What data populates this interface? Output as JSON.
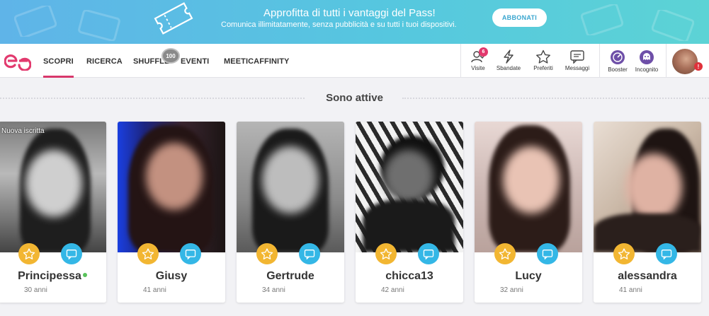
{
  "banner": {
    "title": "Approfitta di tutti i vantaggi del Pass!",
    "subtitle": "Comunica illimitatamente, senza pubblicità e su tutti i tuoi dispositivi.",
    "cta": "ABBONATI"
  },
  "nav": {
    "logo_icon": "meetic-logo",
    "items": [
      "SCOPRI",
      "RICERCA",
      "SHUFFLE",
      "EVENTI",
      "MEETICAFFINITY"
    ],
    "shuffle_count": "100",
    "active": "SCOPRI"
  },
  "actions": [
    {
      "label": "Visite",
      "icon": "visits-icon",
      "badge": "6"
    },
    {
      "label": "Sbandate",
      "icon": "flash-icon"
    },
    {
      "label": "Preferiti",
      "icon": "star-icon"
    },
    {
      "label": "Messaggi",
      "icon": "message-icon"
    },
    {
      "label": "Booster",
      "icon": "booster-icon"
    },
    {
      "label": "Incognito",
      "icon": "incognito-icon"
    }
  ],
  "profile": {
    "alert": "!"
  },
  "section": {
    "title": "Sono attive"
  },
  "cards": [
    {
      "name": "Principessa",
      "age": "30 anni",
      "badge": "Nuova iscritta",
      "online": true
    },
    {
      "name": "Giusy",
      "age": "41 anni"
    },
    {
      "name": "Gertrude",
      "age": "34 anni"
    },
    {
      "name": "chicca13",
      "age": "42 anni"
    },
    {
      "name": "Lucy",
      "age": "32 anni"
    },
    {
      "name": "alessandra",
      "age": "41 anni"
    }
  ],
  "colors": {
    "accent": "#d8386b",
    "favorite": "#f2b632",
    "message": "#34b7e6",
    "online": "#58c25a",
    "banner_start": "#5fb4e8",
    "banner_end": "#5cd3d5"
  }
}
